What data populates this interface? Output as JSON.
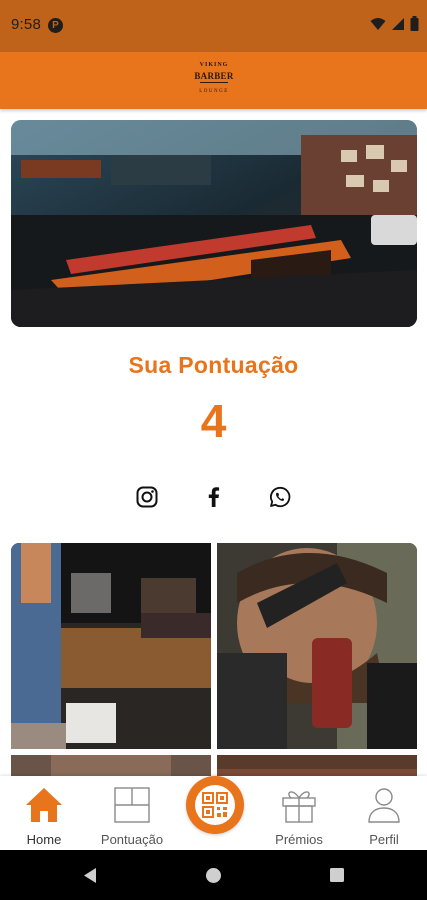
{
  "status_bar": {
    "time": "9:58",
    "app_badge": "P",
    "icons": [
      "wifi-icon",
      "signal-icon",
      "battery-icon"
    ]
  },
  "app_bar": {
    "logo": {
      "line1": "VIKING",
      "line2": "BARBER",
      "line3": "LOUNGE"
    }
  },
  "score": {
    "title": "Sua Pontuação",
    "value": "4"
  },
  "socials": [
    {
      "icon": "instagram-icon"
    },
    {
      "icon": "facebook-icon"
    },
    {
      "icon": "whatsapp-icon"
    }
  ],
  "bottom_nav": {
    "items": [
      {
        "label": "Home",
        "icon": "home-icon",
        "active": true
      },
      {
        "label": "Pontuação",
        "icon": "layout-icon"
      },
      {
        "label": "Prémios",
        "icon": "gift-icon"
      },
      {
        "label": "Perfil",
        "icon": "person-icon"
      }
    ],
    "center_button_icon": "qr-code-icon"
  },
  "system_nav": [
    "back-icon",
    "home-circle-icon",
    "recents-icon"
  ],
  "colors": {
    "primary": "#e8741c",
    "status_bar": "#c0631a",
    "text_dark": "#1e1e1e"
  }
}
